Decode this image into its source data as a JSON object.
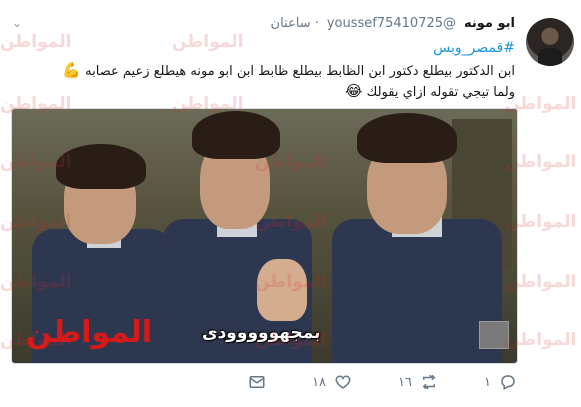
{
  "user": {
    "name": "ابو مونه",
    "handle": "@youssef75410725",
    "time": "· ساعتان"
  },
  "tweet": {
    "hashtag": "#قمصر_وبس",
    "line1": "ابن الدكتور بيطلع دكتور ابن الظابط بيطلع ظابط ابن ابو مونه هيطلع  زعيم عصابه",
    "line1_emoji": "💪",
    "line2": "ولما تيجي تقوله ازاي يقولك",
    "line2_emoji": "😂"
  },
  "media": {
    "subtitle": "بمجهووووودى",
    "logo": "المواطن"
  },
  "watermark_text": "المواطن",
  "actions": {
    "reply_count": "١",
    "retweet_count": "١٦",
    "like_count": "١٨"
  }
}
